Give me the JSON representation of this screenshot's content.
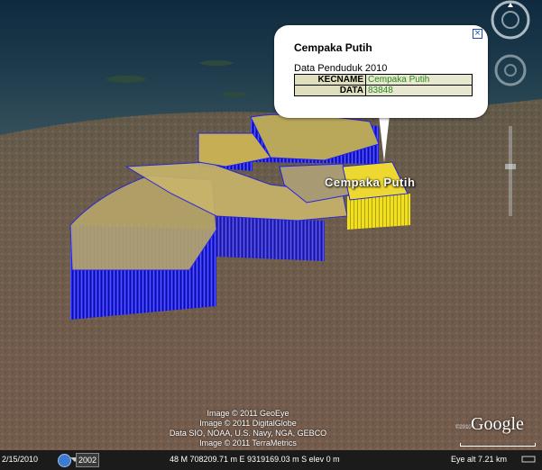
{
  "balloon": {
    "title": "Cempaka Putih",
    "subtitle": "Data Penduduk 2010",
    "close_glyph": "×",
    "rows": [
      {
        "key": "KECNAME",
        "value": "Cempaka Putih"
      },
      {
        "key": "DATA",
        "value": "83848"
      }
    ]
  },
  "place_label": "Cempaka Putih",
  "credits": [
    "Image © 2011 GeoEye",
    "Image © 2011 DigitalGlobe",
    "Data SIO, NOAA, U.S. Navy, NGA, GEBCO",
    "Image © 2011 TerraMetrics"
  ],
  "logo": {
    "text": "Google",
    "year": "©2010"
  },
  "status": {
    "date": "2/15/2010",
    "year_select": "2002",
    "coords": "48 M 708209.71 m E 9319169.03 m S  elev   0 m",
    "eye_alt": "Eye alt    7.21 km"
  },
  "colors": {
    "extrusion_side": "#2323e6",
    "extrusion_top": "#b8a44a",
    "highlight": "#f0e020",
    "tail": "#ffffff"
  }
}
